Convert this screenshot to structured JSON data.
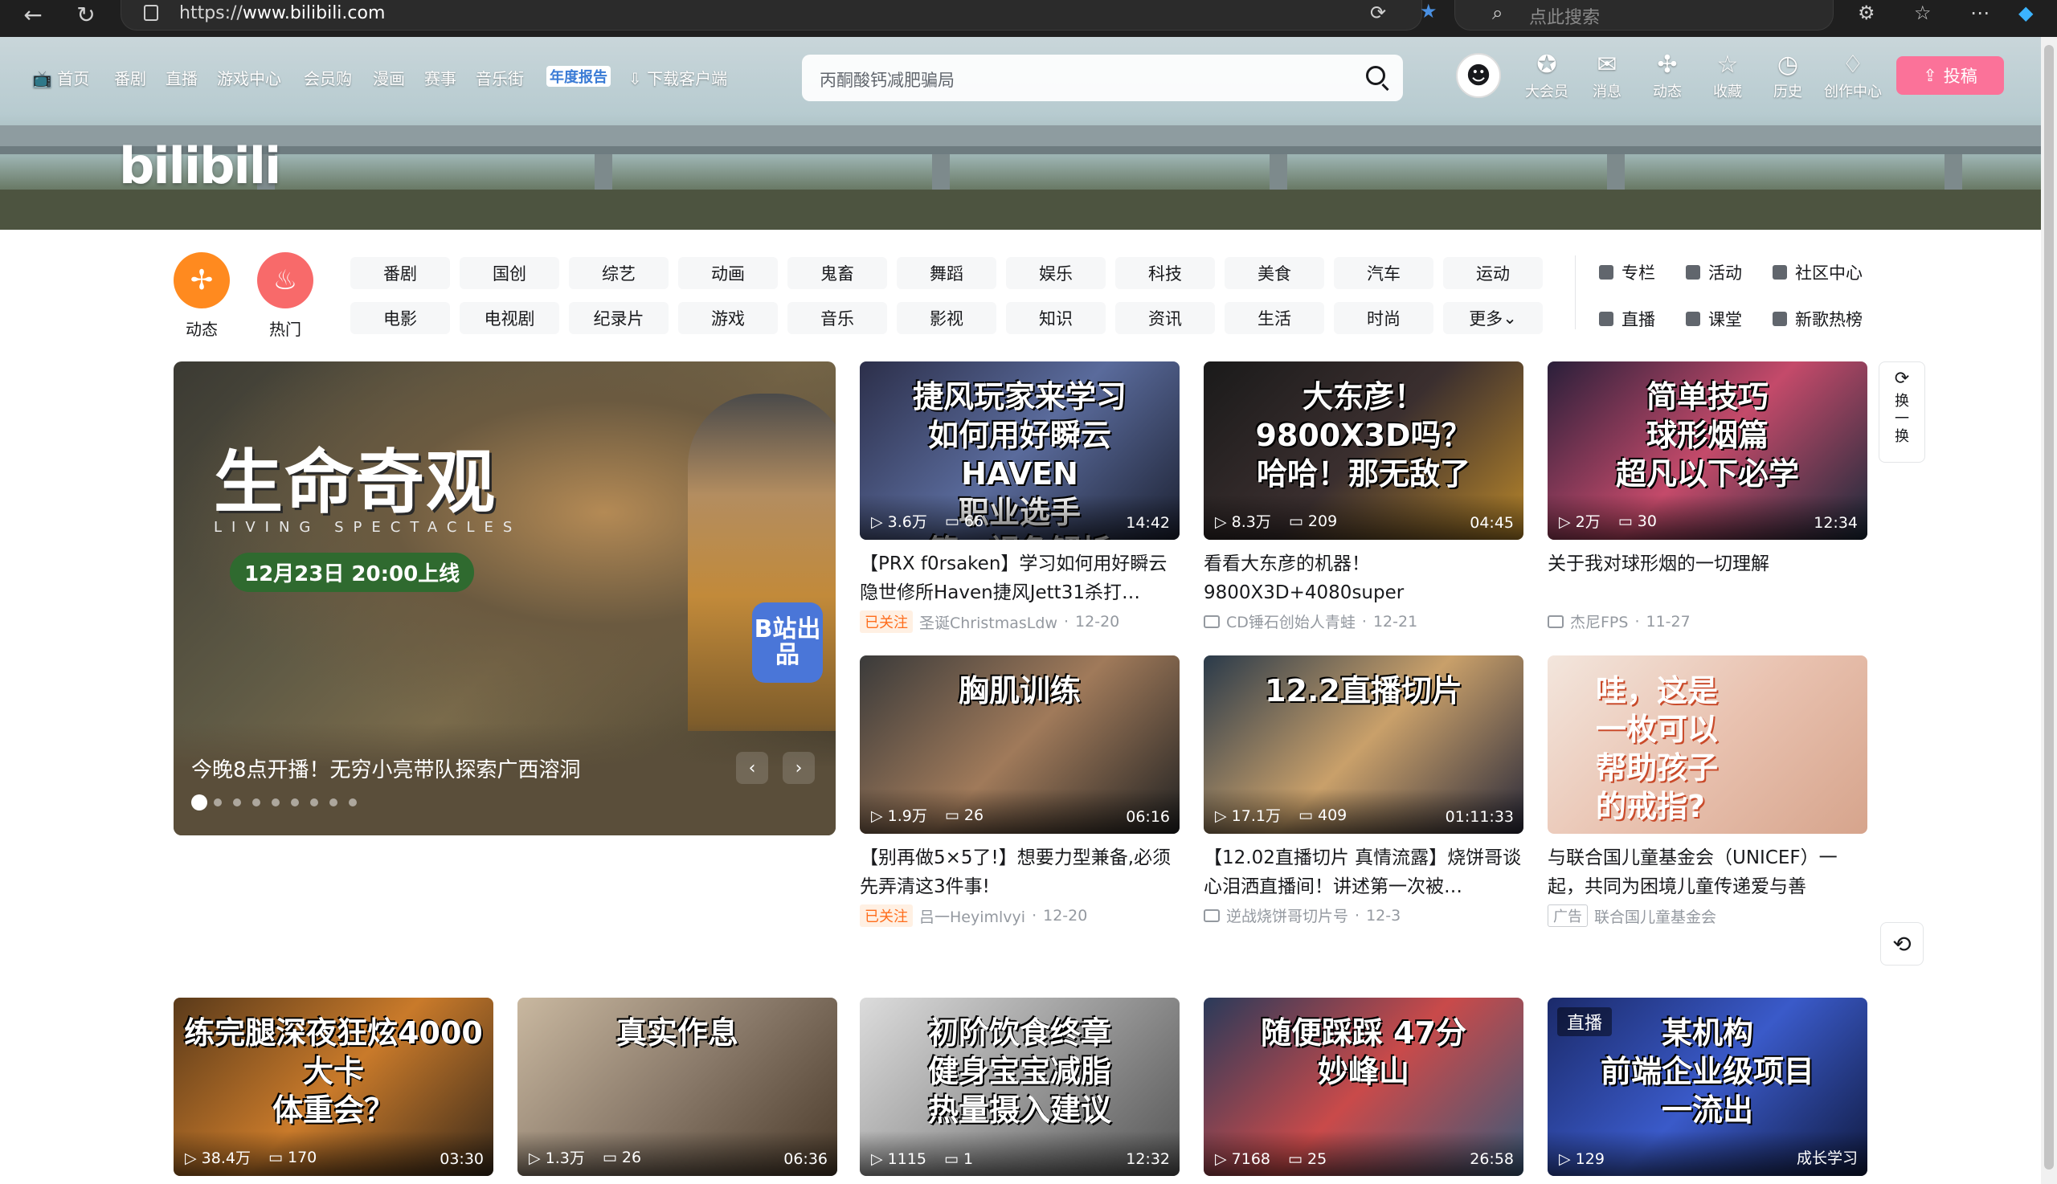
{
  "browser": {
    "url_prefix": "https://",
    "url_host": "www.bilibili.com",
    "search_placeholder": "点此搜索"
  },
  "header": {
    "nav": [
      "首页",
      "番剧",
      "直播",
      "游戏中心",
      "会员购",
      "漫画",
      "赛事",
      "音乐街",
      "年度报告",
      "下载客户端"
    ],
    "logo": "bilibili",
    "search_placeholder": "丙酮酸钙减肥骗局",
    "right_icons": [
      {
        "icon": "vip-icon",
        "label": "大会员"
      },
      {
        "icon": "message-icon",
        "label": "消息"
      },
      {
        "icon": "dynamic-icon",
        "label": "动态"
      },
      {
        "icon": "star-icon",
        "label": "收藏"
      },
      {
        "icon": "clock-icon",
        "label": "历史"
      },
      {
        "icon": "bulb-icon",
        "label": "创作中心"
      }
    ],
    "upload_label": "投稿"
  },
  "channels": {
    "dynamic_label": "动态",
    "hot_label": "热门",
    "row1": [
      "番剧",
      "国创",
      "综艺",
      "动画",
      "鬼畜",
      "舞蹈",
      "娱乐",
      "科技",
      "美食",
      "汽车",
      "运动"
    ],
    "row2": [
      "电影",
      "电视剧",
      "纪录片",
      "游戏",
      "音乐",
      "影视",
      "知识",
      "资讯",
      "生活",
      "时尚",
      "更多"
    ],
    "side_links": [
      "专栏",
      "活动",
      "社区中心",
      "直播",
      "课堂",
      "新歌热榜"
    ]
  },
  "carousel": {
    "headline": "生命奇观",
    "subtitle": "LIVING SPECTACLES",
    "date": "12月23日 20:00上线",
    "badge": "B站出品",
    "caption": "今晚8点开播！无穷小亮带队探索广西溶洞",
    "prev": "‹",
    "next": "›"
  },
  "refresh": {
    "label": "换一换"
  },
  "videos": [
    {
      "overlay": "捷风玩家来学习\n如何用好瞬云\nHAVEN\n职业选手\n第一视角解析",
      "views": "3.6万",
      "danmaku": "66",
      "duration": "14:42",
      "title": "【PRX f0rsaken】学习如何用好瞬云隐世修所Haven捷风Jett31杀打…",
      "follow": "已关注",
      "author": "圣诞ChristmasLdw",
      "date": "12-20"
    },
    {
      "overlay": "大东彦！\n9800X3D吗？\n哈哈！那无敌了",
      "views": "8.3万",
      "danmaku": "209",
      "duration": "04:45",
      "title": "看看大东彦的机器！9800X3D+4080super",
      "author": "CD锤石创始人青蛙",
      "date": "12-21"
    },
    {
      "overlay": "简单技巧\n球形烟篇\n超凡以下必学",
      "views": "2万",
      "danmaku": "30",
      "duration": "12:34",
      "title": "关于我对球形烟的一切理解",
      "author": "杰尼FPS",
      "date": "11-27"
    },
    {
      "overlay": "胸肌训练",
      "views": "1.9万",
      "danmaku": "26",
      "duration": "06:16",
      "title": "【别再做5×5了!】想要力型兼备,必须先弄清这3件事!",
      "follow": "已关注",
      "author": "吕一Heyimlvyi",
      "date": "12-20"
    },
    {
      "overlay": "12.2直播切片",
      "views": "17.1万",
      "danmaku": "409",
      "duration": "01:11:33",
      "title": "【12.02直播切片 真情流露】烧饼哥谈心泪洒直播间！讲述第一次被…",
      "author": "逆战烧饼哥切片号",
      "date": "12-3"
    },
    {
      "overlay": "哇，这是\n一枚可以\n帮助孩子\n的戒指?",
      "views": "",
      "danmaku": "",
      "duration": "",
      "title": "与联合国儿童基金会（UNICEF）一起，共同为困境儿童传递爱与善",
      "ad": "广告",
      "author": "联合国儿童基金会",
      "date": ""
    },
    {
      "overlay": "练完腿深夜狂炫4000大卡\n体重会？",
      "views": "38.4万",
      "danmaku": "170",
      "duration": "03:30"
    },
    {
      "overlay": "真实作息",
      "views": "1.3万",
      "danmaku": "26",
      "duration": "06:36"
    },
    {
      "overlay": "初阶饮食终章\n健身宝宝减脂\n热量摄入建议",
      "views": "1115",
      "danmaku": "1",
      "duration": "12:32"
    },
    {
      "overlay": "随便踩踩 47分\n妙峰山",
      "views": "7168",
      "danmaku": "25",
      "duration": "26:58"
    },
    {
      "overlay": "某机构\n前端企业级项目\n一流出",
      "live": "直播",
      "views": "129",
      "danmaku": "",
      "duration": "成长学习"
    }
  ]
}
